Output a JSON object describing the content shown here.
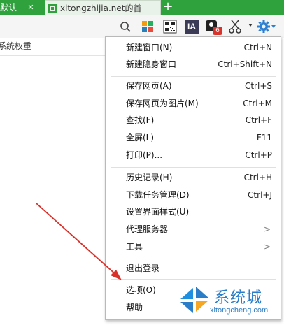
{
  "tabs": [
    {
      "label": "默认",
      "active": true
    },
    {
      "label": "xitongzhijia.net的首",
      "active": false
    }
  ],
  "new_tab_label": "+",
  "toolbar": {
    "ia_label": "IA",
    "badge_count": "6"
  },
  "content": {
    "label": "系统权重"
  },
  "menu": {
    "groups": [
      [
        {
          "label": "新建窗口(N)",
          "shortcut": "Ctrl+N"
        },
        {
          "label": "新建隐身窗口",
          "shortcut": "Ctrl+Shift+N"
        }
      ],
      [
        {
          "label": "保存网页(A)",
          "shortcut": "Ctrl+S"
        },
        {
          "label": "保存网页为图片(M)",
          "shortcut": "Ctrl+M"
        },
        {
          "label": "查找(F)",
          "shortcut": "Ctrl+F"
        },
        {
          "label": "全屏(L)",
          "shortcut": "F11"
        },
        {
          "label": "打印(P)...",
          "shortcut": "Ctrl+P"
        }
      ],
      [
        {
          "label": "历史记录(H)",
          "shortcut": "Ctrl+H"
        },
        {
          "label": "下载任务管理(D)",
          "shortcut": "Ctrl+J"
        },
        {
          "label": "设置界面样式(U)",
          "shortcut": ""
        },
        {
          "label": "代理服务器",
          "shortcut": "",
          "submenu": true
        },
        {
          "label": "工具",
          "shortcut": "",
          "submenu": true
        }
      ],
      [
        {
          "label": "退出登录",
          "shortcut": ""
        }
      ],
      [
        {
          "label": "选项(O)",
          "shortcut": ""
        },
        {
          "label": "帮助",
          "shortcut": ""
        }
      ]
    ]
  },
  "watermark": {
    "text": "系统城",
    "url": "xitongcheng.com"
  },
  "colors": {
    "tab_green": "#2fa23e",
    "annotation_arrow": "#d9302a",
    "watermark_blue": "#2a7dc8"
  }
}
